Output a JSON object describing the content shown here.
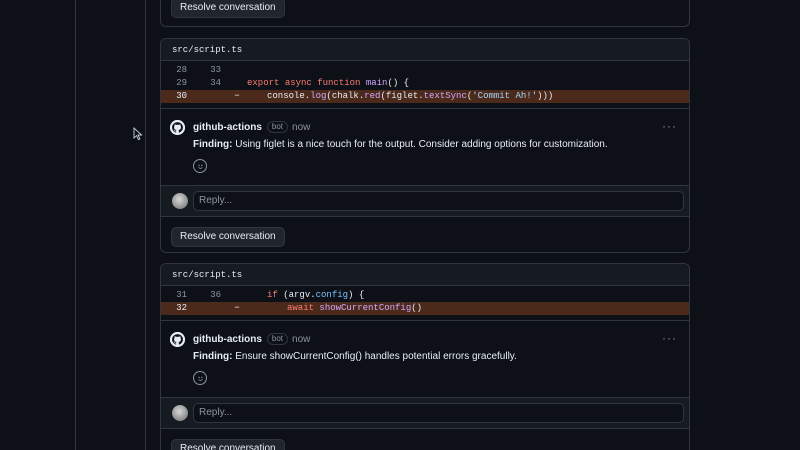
{
  "threads": [
    {
      "resolve_label": "Resolve conversation"
    },
    {
      "file": "src/script.ts",
      "lines": [
        {
          "old": "28",
          "new": "33",
          "marker": "",
          "code": ""
        },
        {
          "old": "29",
          "new": "34",
          "marker": "",
          "code": "export async function main() {"
        },
        {
          "old": "30",
          "new": "",
          "marker": "−",
          "code": "console.log(chalk.red(figlet.textSync('Commit Ah!')))"
        }
      ],
      "comment": {
        "author": "github-actions",
        "badge": "bot",
        "time": "now",
        "more": "···",
        "label": "Finding:",
        "text": " Using figlet is a nice touch for the output. Consider adding options for customization."
      },
      "reply_placeholder": "Reply...",
      "resolve_label": "Resolve conversation"
    },
    {
      "file": "src/script.ts",
      "lines": [
        {
          "old": "31",
          "new": "36",
          "marker": "",
          "code": "if (argv.config) {"
        },
        {
          "old": "32",
          "new": "",
          "marker": "−",
          "code": "await showCurrentConfig()"
        }
      ],
      "comment": {
        "author": "github-actions",
        "badge": "bot",
        "time": "now",
        "more": "···",
        "label": "Finding:",
        "text": " Ensure showCurrentConfig() handles potential errors gracefully."
      },
      "reply_placeholder": "Reply...",
      "resolve_label": "Resolve conversation"
    }
  ],
  "icons": {
    "author_avatar": "github-mark-icon",
    "emoji": "smiley-icon",
    "more": "kebab-horizontal-icon",
    "cursor": "mouse-pointer-icon"
  },
  "colors": {
    "background": "#0d1117",
    "panel": "#161b22",
    "border": "#30363d",
    "deleted_line": "#4b2a1c",
    "text": "#e6edf3",
    "muted": "#8b949e",
    "keyword": "#ff7b72",
    "function": "#d2a8ff",
    "string": "#a5d6ff"
  }
}
